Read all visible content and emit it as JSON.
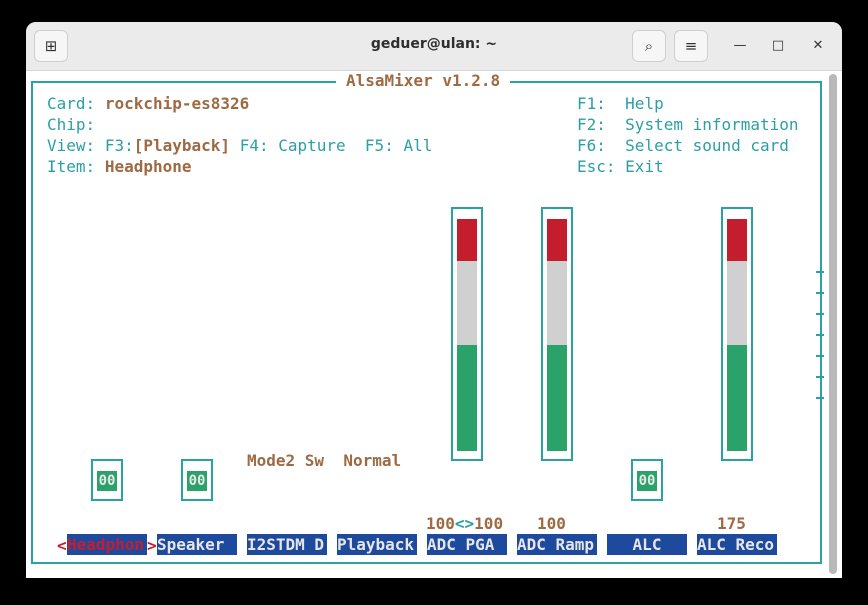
{
  "window": {
    "title": "geduer@ulan: ~",
    "new_tab_icon": "new-tab-icon",
    "search_icon": "search-icon",
    "menu_icon": "hamburger-menu-icon"
  },
  "mixer": {
    "title": "AlsaMixer v1.2.8",
    "card_label": "Card:",
    "card_value": "rockchip-es8326",
    "chip_label": "Chip:",
    "view_label": "View:",
    "view_f3": "F3:",
    "view_playback": "[Playback]",
    "view_f4": "F4: Capture",
    "view_f5": "F5: All",
    "item_label": "Item:",
    "item_value": "Headphone",
    "help": [
      {
        "key": "F1:",
        "text": "Help"
      },
      {
        "key": "F2:",
        "text": "System information"
      },
      {
        "key": "F6:",
        "text": "Select sound card"
      },
      {
        "key": "Esc:",
        "text": "Exit"
      }
    ],
    "mode_label": "Mode2 Sw",
    "mode_value": "Normal",
    "switch_value": "00",
    "values": {
      "adc_pga": "100<>100",
      "adc_pga_left": "100",
      "adc_pga_sep": "<>",
      "adc_pga_right": "100",
      "adc_ramp": "100",
      "alc_reco": "175"
    },
    "controls": [
      {
        "label": "Headphon",
        "selected": true
      },
      {
        "label": "Speaker",
        "selected": false
      },
      {
        "label": "I2STDM D",
        "selected": false
      },
      {
        "label": "Playback",
        "selected": false
      },
      {
        "label": "ADC PGA",
        "selected": false
      },
      {
        "label": "ADC Ramp",
        "selected": false
      },
      {
        "label": "ALC",
        "selected": false
      },
      {
        "label": "ALC Reco",
        "selected": false
      }
    ],
    "selected_prefix": "<",
    "selected_suffix": ">",
    "colors": {
      "accent": "#2ba2a2",
      "label_bg": "#1e4a9e",
      "bar_red": "#c41e2e",
      "bar_white": "#d0d0d0",
      "bar_green": "#2aa26a",
      "bold_text": "#9e6a43"
    }
  }
}
